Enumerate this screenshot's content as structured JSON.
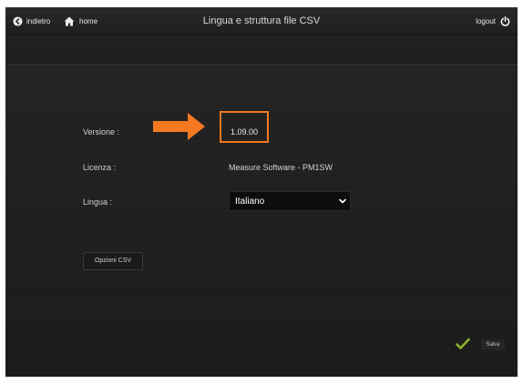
{
  "header": {
    "back_label": "indietro",
    "home_label": "home",
    "title": "Lingua e struttura file CSV",
    "logout_label": "logout"
  },
  "form": {
    "version_label": "Versione :",
    "version_value": "1.09.00",
    "license_label": "Licenza :",
    "license_value": "Measure Software - PM1SW",
    "language_label": "Lingua :",
    "language_selected": "Italiano"
  },
  "buttons": {
    "csv_options_label": "Opzioni CSV",
    "save_label": "Salva"
  },
  "icons": {
    "back": "back-arrow-circle-icon",
    "home": "home-icon",
    "logout": "power-icon",
    "dropdown": "chevron-down-icon",
    "save": "checkmark-icon",
    "annotation": "arrow-right-icon"
  },
  "colors": {
    "annotation_accent": "#f47920",
    "save_check": "#8db32c",
    "background": "#1c1c1c"
  }
}
